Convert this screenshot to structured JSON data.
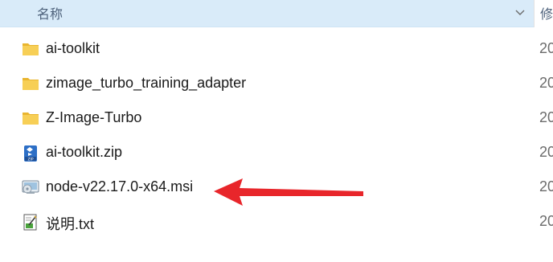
{
  "header": {
    "name_label": "名称",
    "modified_label": "修"
  },
  "files": [
    {
      "name": "ai-toolkit",
      "icon": "folder-icon",
      "date": "20"
    },
    {
      "name": "zimage_turbo_training_adapter",
      "icon": "folder-icon",
      "date": "20"
    },
    {
      "name": "Z-Image-Turbo",
      "icon": "folder-icon",
      "date": "20"
    },
    {
      "name": "ai-toolkit.zip",
      "icon": "zip-archive-icon",
      "date": "20"
    },
    {
      "name": "node-v22.17.0-x64.msi",
      "icon": "msi-installer-icon",
      "date": "20"
    },
    {
      "name": "说明.txt",
      "icon": "text-file-icon",
      "date": "20"
    }
  ],
  "annotation": {
    "icon": "red-arrow-icon",
    "color": "#e8262b"
  },
  "colors": {
    "header_bg": "#d9ebf9",
    "folder": "#f4c542"
  }
}
